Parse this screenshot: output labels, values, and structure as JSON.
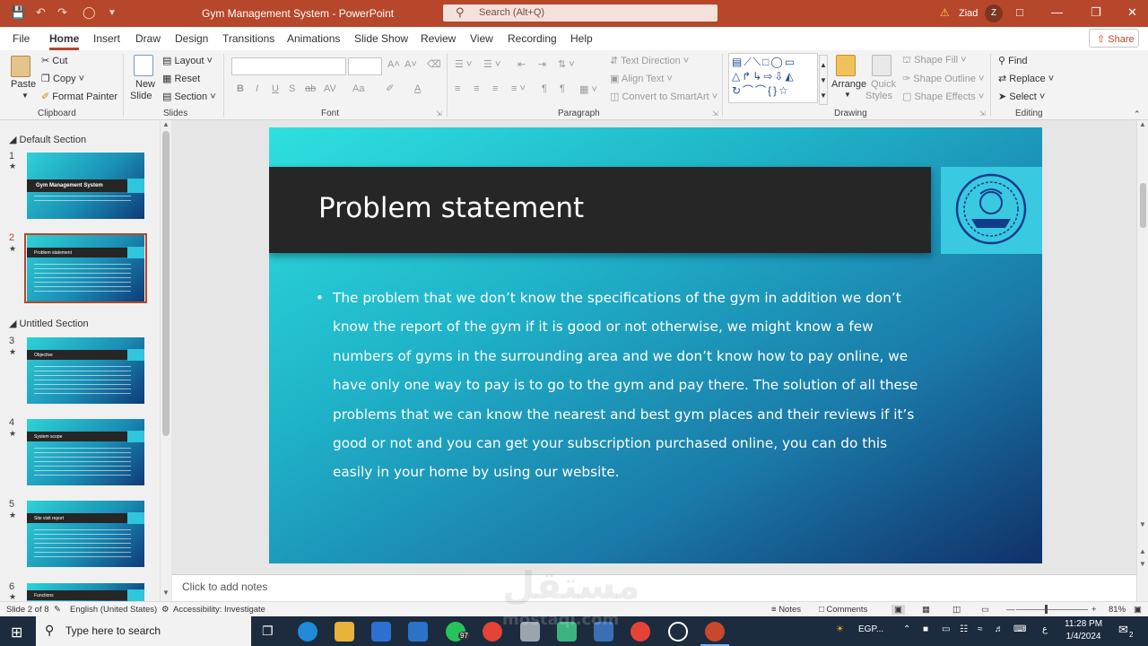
{
  "app": {
    "title": "Gym Management System  -  PowerPoint",
    "search_placeholder": "Search (Alt+Q)",
    "user_name": "Ziad",
    "user_initial": "Z",
    "share_label": "Share",
    "accent_color": "#b7472a"
  },
  "menu": {
    "tabs": [
      "File",
      "Home",
      "Insert",
      "Draw",
      "Design",
      "Transitions",
      "Animations",
      "Slide Show",
      "Review",
      "View",
      "Recording",
      "Help"
    ],
    "active": "Home"
  },
  "ribbon": {
    "clipboard": {
      "paste": "Paste",
      "cut": "Cut",
      "copy": "Copy",
      "format_painter": "Format Painter",
      "label": "Clipboard"
    },
    "slides": {
      "new_line1": "New",
      "new_line2": "Slide",
      "layout": "Layout",
      "reset": "Reset",
      "section": "Section",
      "label": "Slides"
    },
    "font": {
      "label": "Font",
      "bold": "B",
      "italic": "I",
      "underline": "U",
      "strike": "S",
      "shadow": "ab",
      "spacing": "AV",
      "case": "Aa",
      "grow": "A˄",
      "shrink": "A˅"
    },
    "paragraph": {
      "text_direction": "Text Direction",
      "align_text": "Align Text",
      "convert_smartart": "Convert to SmartArt",
      "label": "Paragraph"
    },
    "drawing": {
      "arrange": "Arrange",
      "quick_styles_1": "Quick",
      "quick_styles_2": "Styles",
      "shape_fill": "Shape Fill",
      "shape_outline": "Shape Outline",
      "shape_effects": "Shape Effects",
      "label": "Drawing"
    },
    "editing": {
      "find": "Find",
      "replace": "Replace",
      "select": "Select",
      "label": "Editing"
    }
  },
  "slide_panel": {
    "sections": [
      "Default Section",
      "Untitled Section"
    ],
    "slides": [
      {
        "num": "1",
        "title": "Gym Management System"
      },
      {
        "num": "2",
        "title": "Problem statement"
      },
      {
        "num": "3",
        "title": "Objective"
      },
      {
        "num": "4",
        "title": "System scope"
      },
      {
        "num": "5",
        "title": "Site visit report"
      },
      {
        "num": "6",
        "title": "Functions"
      }
    ],
    "selected": "2"
  },
  "slide": {
    "title": "Problem statement",
    "bullet": "The problem that we don’t know the specifications of the gym in addition we don’t know the report of the gym if it is good or not otherwise, we might know a few numbers of gyms in the surrounding area and we don’t know how to pay online, we have only one way to pay is to go to the gym and pay there. The solution of all these problems that we can know the nearest and best gym places and their reviews if it’s good or not and you can get your subscription purchased online, you can do this easily in your home by using our website."
  },
  "notes": {
    "placeholder": "Click to add notes"
  },
  "status": {
    "slide_info": "Slide 2 of 8",
    "language": "English (United States)",
    "accessibility": "Accessibility: Investigate",
    "notes": "Notes",
    "comments": "Comments",
    "zoom": "81%",
    "zoom_level": 0.81
  },
  "taskbar": {
    "search": "Type here to search",
    "whatsapp_badge": "97",
    "weather": "EGP...",
    "lang": "ع",
    "time": "11:28 PM",
    "date": "1/4/2024",
    "notification_count": "2"
  },
  "watermark": {
    "line1": "مستقل",
    "line2": "mostaql.com"
  }
}
